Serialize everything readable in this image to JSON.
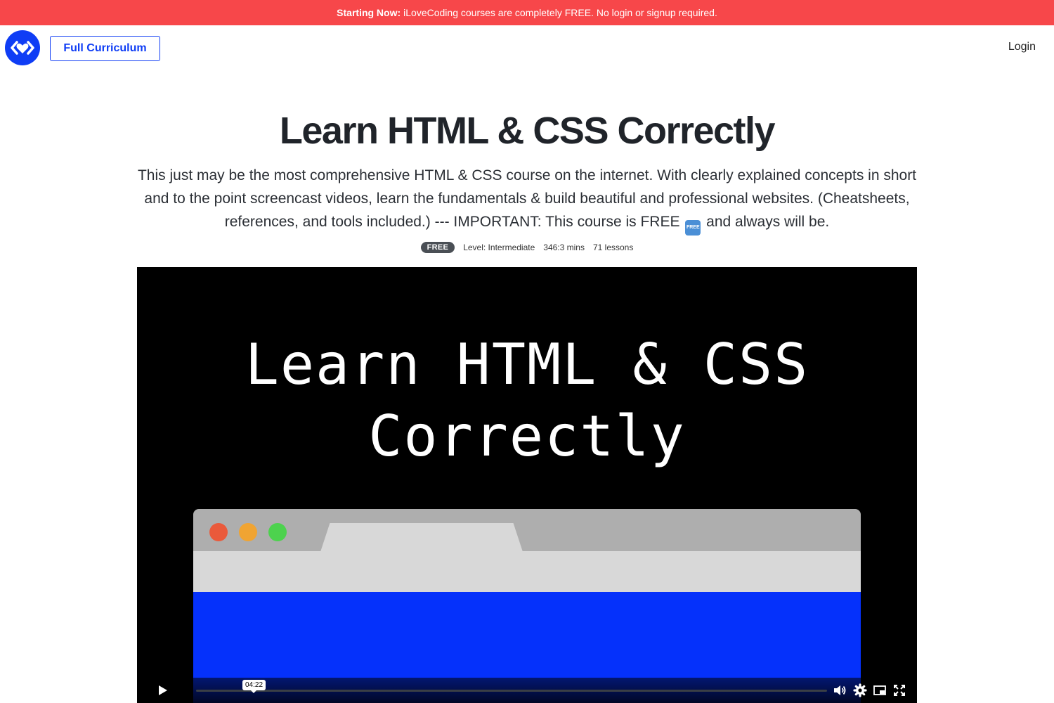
{
  "announcement": {
    "bold": "Starting Now:",
    "text": "iLoveCoding courses are completely FREE. No login or signup required."
  },
  "header": {
    "logo_icon": "ilovecoding-heart-code-logo",
    "curriculum_label": "Full Curriculum",
    "login_label": "Login"
  },
  "course": {
    "title": "Learn HTML & CSS Correctly",
    "description_before": "This just may be the most comprehensive HTML & CSS course on the internet. With clearly explained concepts in short and to the point screencast videos, learn the fundamentals & build beautiful and professional websites. (Cheatsheets, references, and tools included.) --- IMPORTANT: This course is FREE",
    "free_emoji": "FREE",
    "description_after": "and always will be.",
    "badge": "FREE",
    "level": "Level: Intermediate",
    "duration": "346:3 mins",
    "lessons": "71 lessons"
  },
  "video": {
    "title_line1": "Learn HTML & CSS",
    "title_line2": "Correctly",
    "time": "04:22",
    "controls": [
      "play-icon",
      "volume-icon",
      "settings-icon",
      "pip-icon",
      "fullscreen-icon"
    ]
  },
  "colors": {
    "announcement_bg": "#f7474a",
    "brand_blue": "#0f3df5",
    "video_page_blue": "#0531fb",
    "badge_bg": "#4a4f55"
  }
}
